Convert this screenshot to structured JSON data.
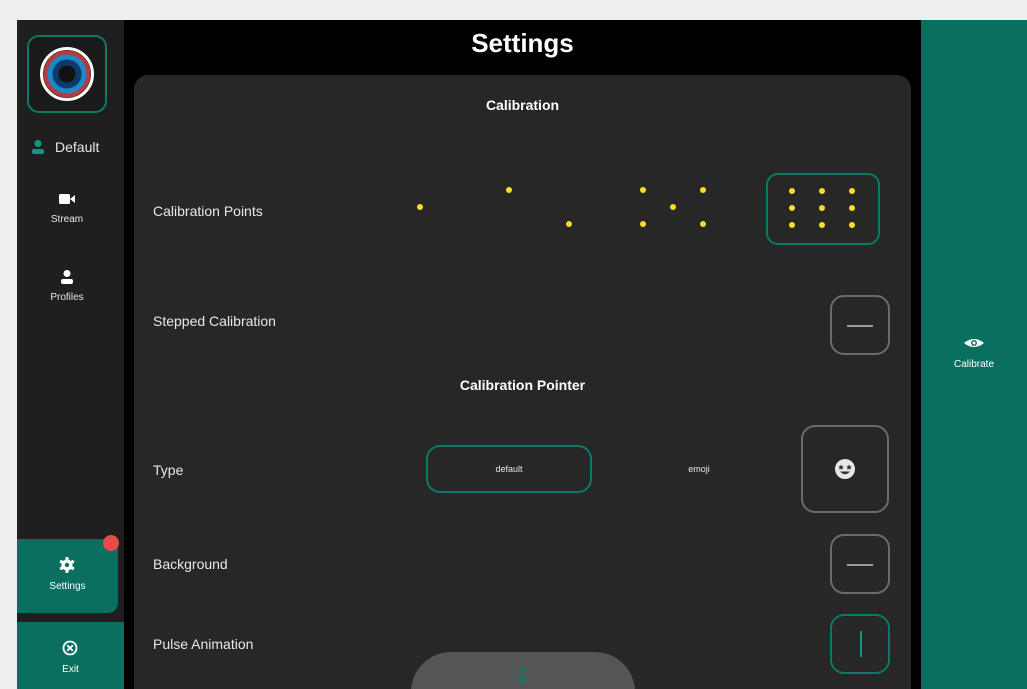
{
  "header": {
    "title": "Settings"
  },
  "sidebar": {
    "profile_name": "Default",
    "nav": {
      "stream": "Stream",
      "profiles": "Profiles",
      "settings": "Settings",
      "exit": "Exit"
    }
  },
  "sections": {
    "calibration": "Calibration",
    "calibration_pointer": "Calibration Pointer"
  },
  "rows": {
    "calibration_points": "Calibration Points",
    "stepped_calibration": "Stepped Calibration",
    "type": "Type",
    "background": "Background",
    "pulse_animation": "Pulse Animation"
  },
  "calibration_point_options": [
    1,
    3,
    5,
    9
  ],
  "calibration_points_selected": 9,
  "stepped_calibration_on": false,
  "background_on": false,
  "pulse_animation_on": true,
  "type_options": {
    "default": "default",
    "emoji": "emoji"
  },
  "type_selected": "default",
  "right_rail": {
    "calibrate_label": "Calibrate"
  },
  "colors": {
    "accent": "#0b6f60",
    "dot": "#f5de2a",
    "panel": "#272727",
    "badge": "#e84a4a"
  }
}
